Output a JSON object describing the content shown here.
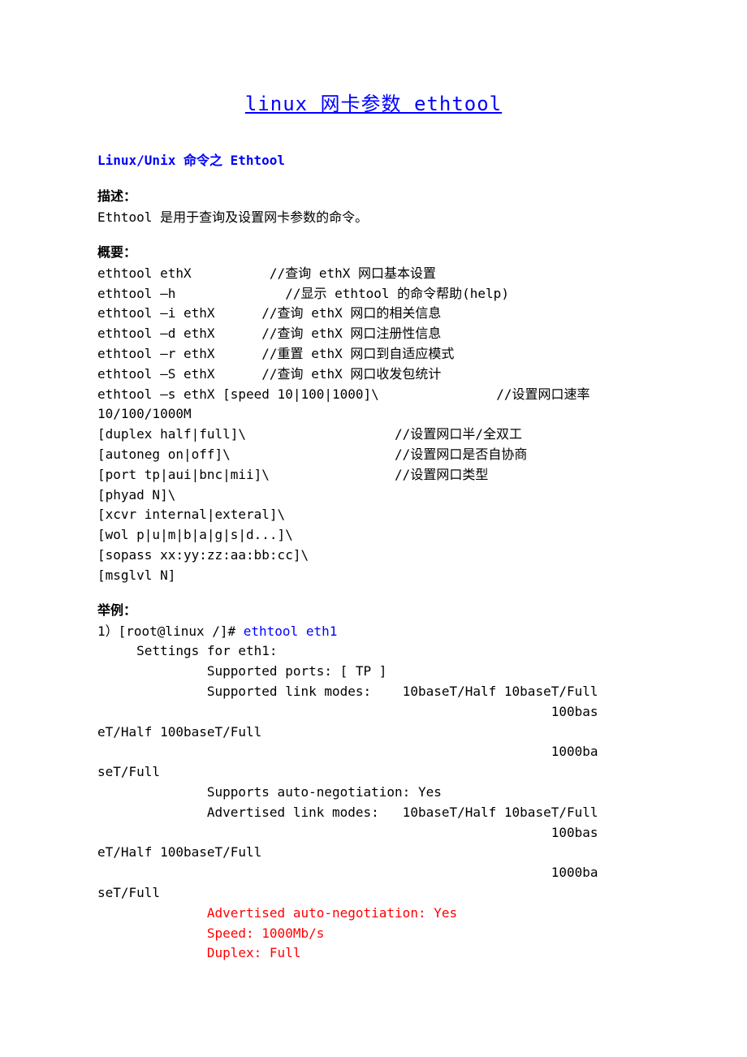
{
  "title": "linux 网卡参数 ethtool",
  "subtitle": "Linux/Unix 命令之 Ethtool",
  "descHeading": "描述：",
  "desc": "Ethtool 是用于查询及设置网卡参数的命令。",
  "synopsisHeading": "概要：",
  "syn": {
    "l1a": "ethtool ethX          //查询 ethX 网口基本设置",
    "l2a": "ethtool –h              //显示 ethtool 的命令帮助(help)",
    "l3a": "ethtool –i ethX      //查询 ethX 网口的相关信息",
    "l4a": "ethtool –d ethX      //查询 ethX 网口注册性信息",
    "l5a": "ethtool –r ethX      //重置 ethX 网口到自适应模式",
    "l6a": "ethtool –S ethX      //查询 ethX 网口收发包统计",
    "l7a": "ethtool –s ethX [speed 10|100|1000]\\               //设置网口速率",
    "l7b": "10/100/1000M",
    "l8a": "[duplex half|full]\\                   //设置网口半/全双工",
    "l9a": "[autoneg on|off]\\                     //设置网口是否自协商",
    "l10a": "[port tp|aui|bnc|mii]\\                //设置网口类型",
    "l11a": "[phyad N]\\",
    "l12a": "[xcvr internal|exteral]\\",
    "l13a": "[wol p|u|m|b|a|g|s|d...]\\",
    "l14a": "[sopass xx:yy:zz:aa:bb:cc]\\",
    "l15a": "[msglvl N]"
  },
  "exampleHeading": "举例：",
  "ex": {
    "prompt": "1）[root@linux /]# ",
    "cmd": "ethtool eth1",
    "l1": "     Settings for eth1:",
    "l2": "              Supported ports: [ TP ]",
    "l3": "              Supported link modes:    10baseT/Half 10baseT/Full",
    "l4": "                                                          100bas",
    "l5": "eT/Half 100baseT/Full",
    "l6": "                                                          1000ba",
    "l7": "seT/Full",
    "l8": "              Supports auto-negotiation: Yes",
    "l9": "              Advertised link modes:   10baseT/Half 10baseT/Full",
    "l10": "                                                          100bas",
    "l11": "eT/Half 100baseT/Full",
    "l12": "                                                          1000ba",
    "l13": "seT/Full",
    "r1": "              Advertised auto-negotiation: Yes",
    "r2": "              Speed: 1000Mb/s",
    "r3": "              Duplex: Full"
  }
}
